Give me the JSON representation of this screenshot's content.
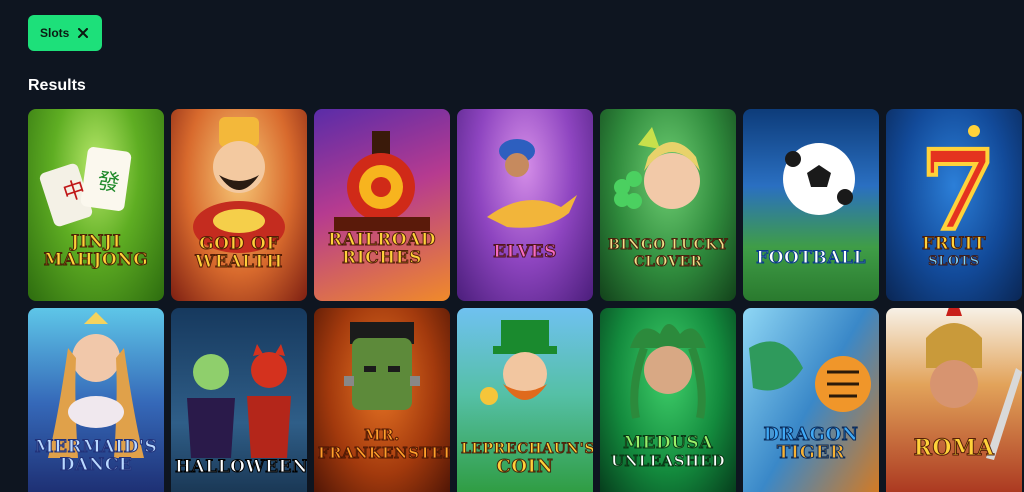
{
  "filters": {
    "active_chip": {
      "label": "Slots",
      "remove_icon": "close-icon"
    }
  },
  "section": {
    "title": "Results"
  },
  "games": [
    {
      "title_line1": "JinJi",
      "title_line2": "Mahjong"
    },
    {
      "title_line1": "God of",
      "title_line2": "Wealth"
    },
    {
      "title_line1": "Railroad",
      "title_line2": "Riches"
    },
    {
      "title_line1": "Elves",
      "title_line2": ""
    },
    {
      "title_line1": "Bingo Lucky",
      "title_line2": "Clover"
    },
    {
      "title_line1": "Football",
      "title_line2": ""
    },
    {
      "title_line1": "Fruit",
      "title_line2": "Slots"
    },
    {
      "title_line1": "Mermaid's",
      "title_line2": "Dance"
    },
    {
      "title_line1": "Halloween",
      "title_line2": ""
    },
    {
      "title_line1": "Mr.",
      "title_line2": "Frankenstein"
    },
    {
      "title_line1": "Leprechaun's",
      "title_line2": "Coin"
    },
    {
      "title_line1": "Medusa",
      "title_line2": "Unleashed"
    },
    {
      "title_line1": "Dragon",
      "title_line2": "Tiger"
    },
    {
      "title_line1": "Roma",
      "title_line2": ""
    }
  ]
}
